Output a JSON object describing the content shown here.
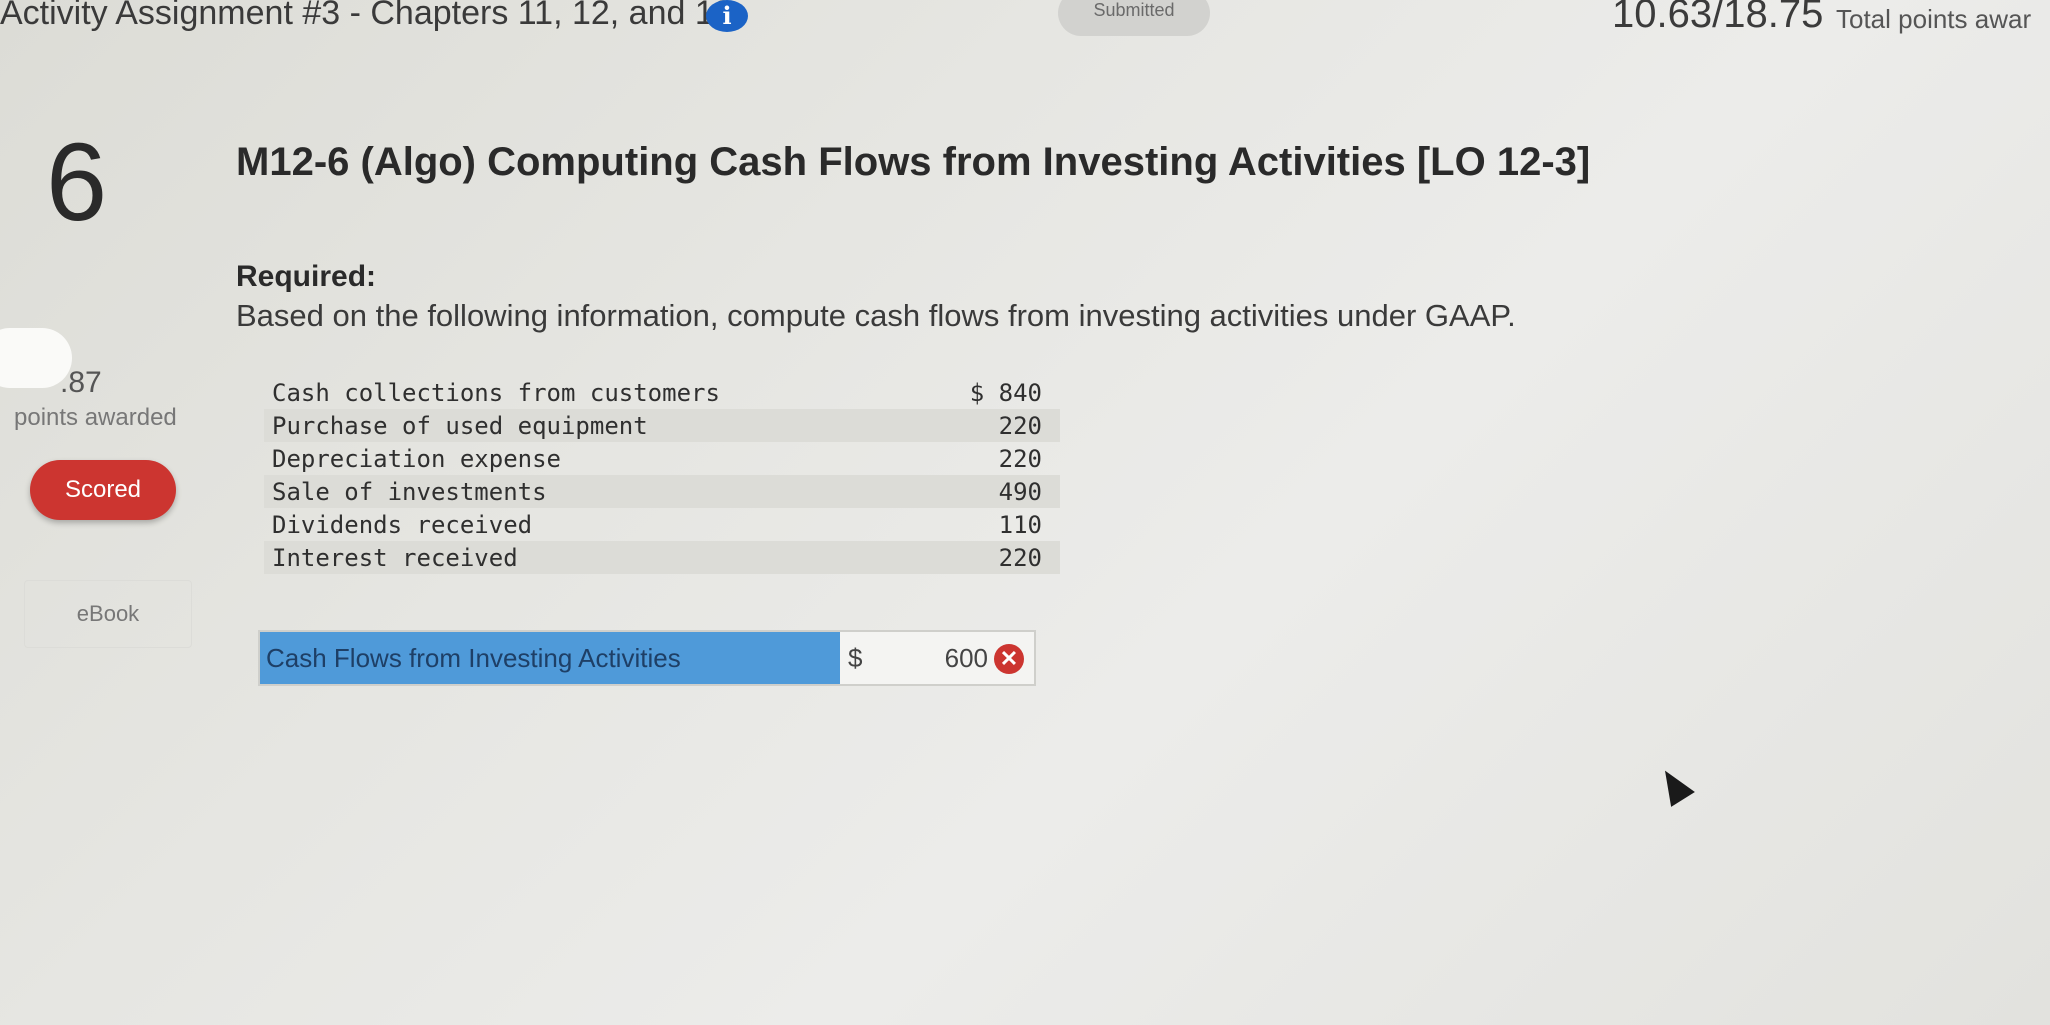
{
  "header": {
    "assignment_title": "Activity Assignment #3 - Chapters 11, 12, and 13",
    "status_label": "Submitted",
    "points_total": "10.63/18.75",
    "points_total_label": "Total points awar"
  },
  "question": {
    "number": "6",
    "score": ".87",
    "points_awarded_label": "points awarded",
    "status_badge": "Scored",
    "ebook_label": "eBook",
    "heading": "M12-6 (Algo) Computing Cash Flows from Investing Activities [LO 12-3]",
    "required_label": "Required:",
    "required_text": "Based on the following information, compute cash flows from investing activities under GAAP."
  },
  "given_table": {
    "rows": [
      {
        "label": "Cash collections from customers",
        "amount": "$ 840"
      },
      {
        "label": "Purchase of used equipment",
        "amount": "220"
      },
      {
        "label": "Depreciation expense",
        "amount": "220"
      },
      {
        "label": "Sale of investments",
        "amount": "490"
      },
      {
        "label": "Dividends received",
        "amount": "110"
      },
      {
        "label": "Interest received",
        "amount": "220"
      }
    ]
  },
  "answer": {
    "label": "Cash Flows from Investing Activities",
    "currency": "$",
    "value": "600",
    "result_icon": "incorrect-x-icon"
  },
  "colors": {
    "accent_blue": "#4f9ad9",
    "scored_red": "#cc3530",
    "info_blue": "#1b63c6"
  }
}
